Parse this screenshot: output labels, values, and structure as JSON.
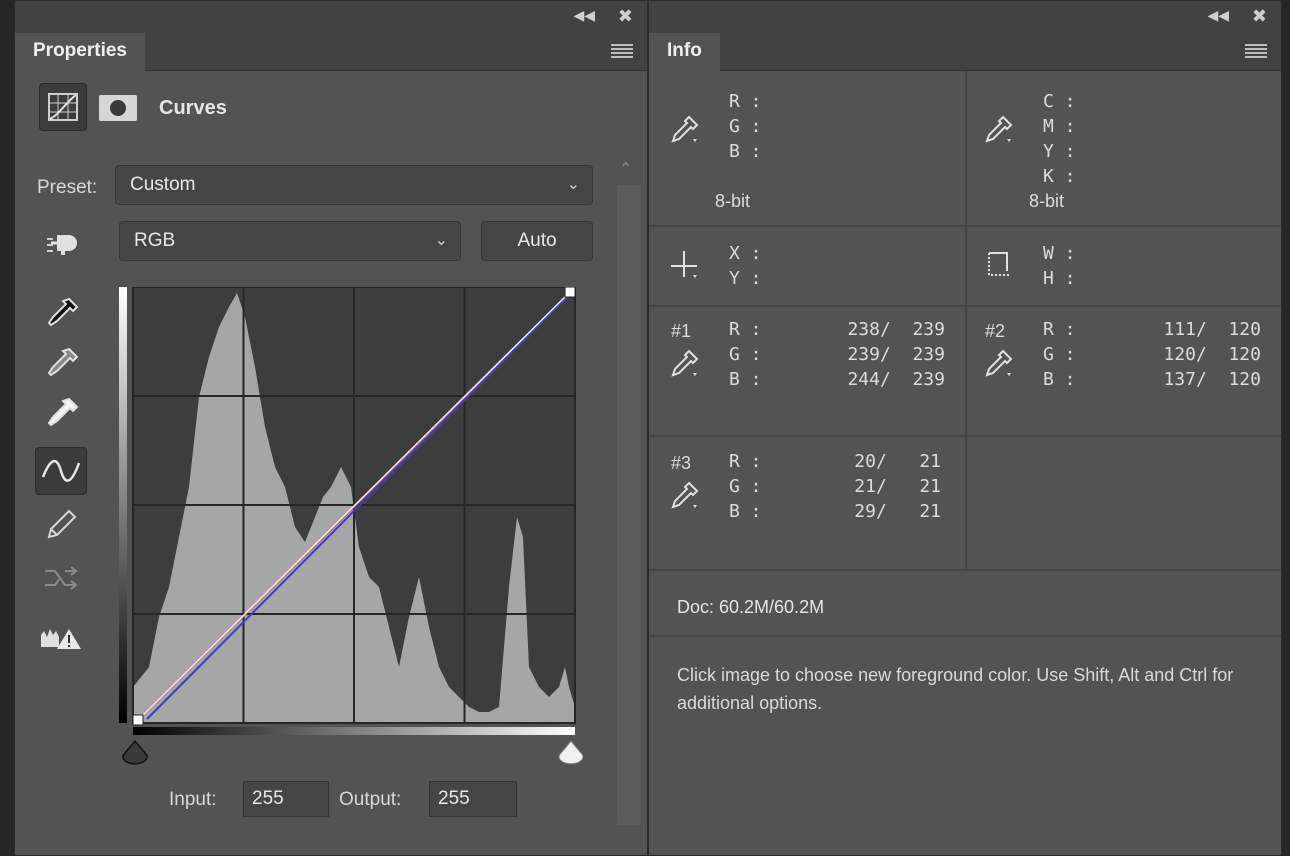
{
  "properties": {
    "tab": "Properties",
    "title": "Curves",
    "preset_label": "Preset:",
    "preset_value": "Custom",
    "channel_value": "RGB",
    "auto_label": "Auto",
    "input_label": "Input:",
    "input_value": "255",
    "output_label": "Output:",
    "output_value": "255"
  },
  "info": {
    "tab": "Info",
    "rgb_readout": {
      "labels": "R :\nG :\nB :",
      "bit": "8-bit"
    },
    "cmyk_readout": {
      "labels": "C :\nM :\nY :\nK :",
      "bit": "8-bit"
    },
    "xy_readout": {
      "labels": "X :\nY :"
    },
    "wh_readout": {
      "labels": "W :\nH :"
    },
    "samples": [
      {
        "id": "#1",
        "labels": "R :\nG :\nB :",
        "values": "238/  239\n239/  239\n244/  239"
      },
      {
        "id": "#2",
        "labels": "R :\nG :\nB :",
        "values": "111/  120\n120/  120\n137/  120"
      },
      {
        "id": "#3",
        "labels": "R :\nG :\nB :",
        "values": "20/   21\n21/   21\n29/   21"
      }
    ],
    "doc": "Doc: 60.2M/60.2M",
    "hint": "Click image to choose new foreground color.  Use Shift, Alt and Ctrl for additional options."
  },
  "colors": {
    "panel_bg": "#535353",
    "header_bg": "#424242",
    "red_curve": "#c8503c",
    "blue_curve": "#3c3cc8",
    "rgb_curve": "#f0f0f0"
  },
  "icons": [
    "collapse-icon",
    "close-icon",
    "panel-menu-icon",
    "curves-adjustment-icon",
    "mask-icon",
    "target-adjust-icon",
    "black-eyedropper-icon",
    "gray-eyedropper-icon",
    "white-eyedropper-icon",
    "curve-tool-icon",
    "pencil-icon",
    "smooth-icon",
    "clipping-warning-icon",
    "eyedropper-icon",
    "crosshair-icon",
    "selection-size-icon"
  ]
}
